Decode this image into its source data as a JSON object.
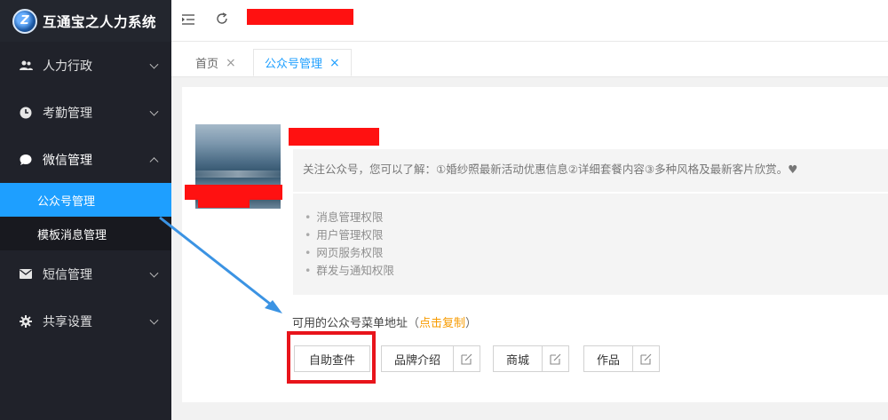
{
  "brand": {
    "logo_text": "Z",
    "title": "互通宝之人力系统"
  },
  "sidebar": {
    "items": [
      {
        "label": "人力行政",
        "icon": "users-icon"
      },
      {
        "label": "考勤管理",
        "icon": "clock-icon"
      },
      {
        "label": "微信管理",
        "icon": "chat-icon",
        "expanded": true,
        "children": [
          {
            "label": "公众号管理",
            "active": true
          },
          {
            "label": "模板消息管理"
          }
        ]
      },
      {
        "label": "短信管理",
        "icon": "mail-icon"
      },
      {
        "label": "共享设置",
        "icon": "gear-icon"
      }
    ]
  },
  "topbar": {
    "collapse_icon": "menu-collapse-icon",
    "refresh_icon": "refresh-icon"
  },
  "tabs": [
    {
      "label": "首页",
      "close": "×"
    },
    {
      "label": "公众号管理",
      "close": "×",
      "active": true
    }
  ],
  "account": {
    "intro": "关注公众号，您可以了解：①婚纱照最新活动优惠信息②详细套餐内容③多种风格及最新客片欣赏。♥",
    "permissions": [
      "消息管理权限",
      "用户管理权限",
      "网页服务权限",
      "群发与通知权限"
    ],
    "menu_url_label": "可用的公众号菜单地址",
    "paren_open": "（",
    "copy_link": "点击复制",
    "paren_close": "）"
  },
  "menu_buttons": [
    "自助查件",
    "品牌介绍",
    "商城",
    "作品"
  ],
  "colors": {
    "accent": "#1e9fff",
    "sidebar_bg": "#20222a",
    "highlight": "#e8141b",
    "copy_link": "#f79b00"
  }
}
